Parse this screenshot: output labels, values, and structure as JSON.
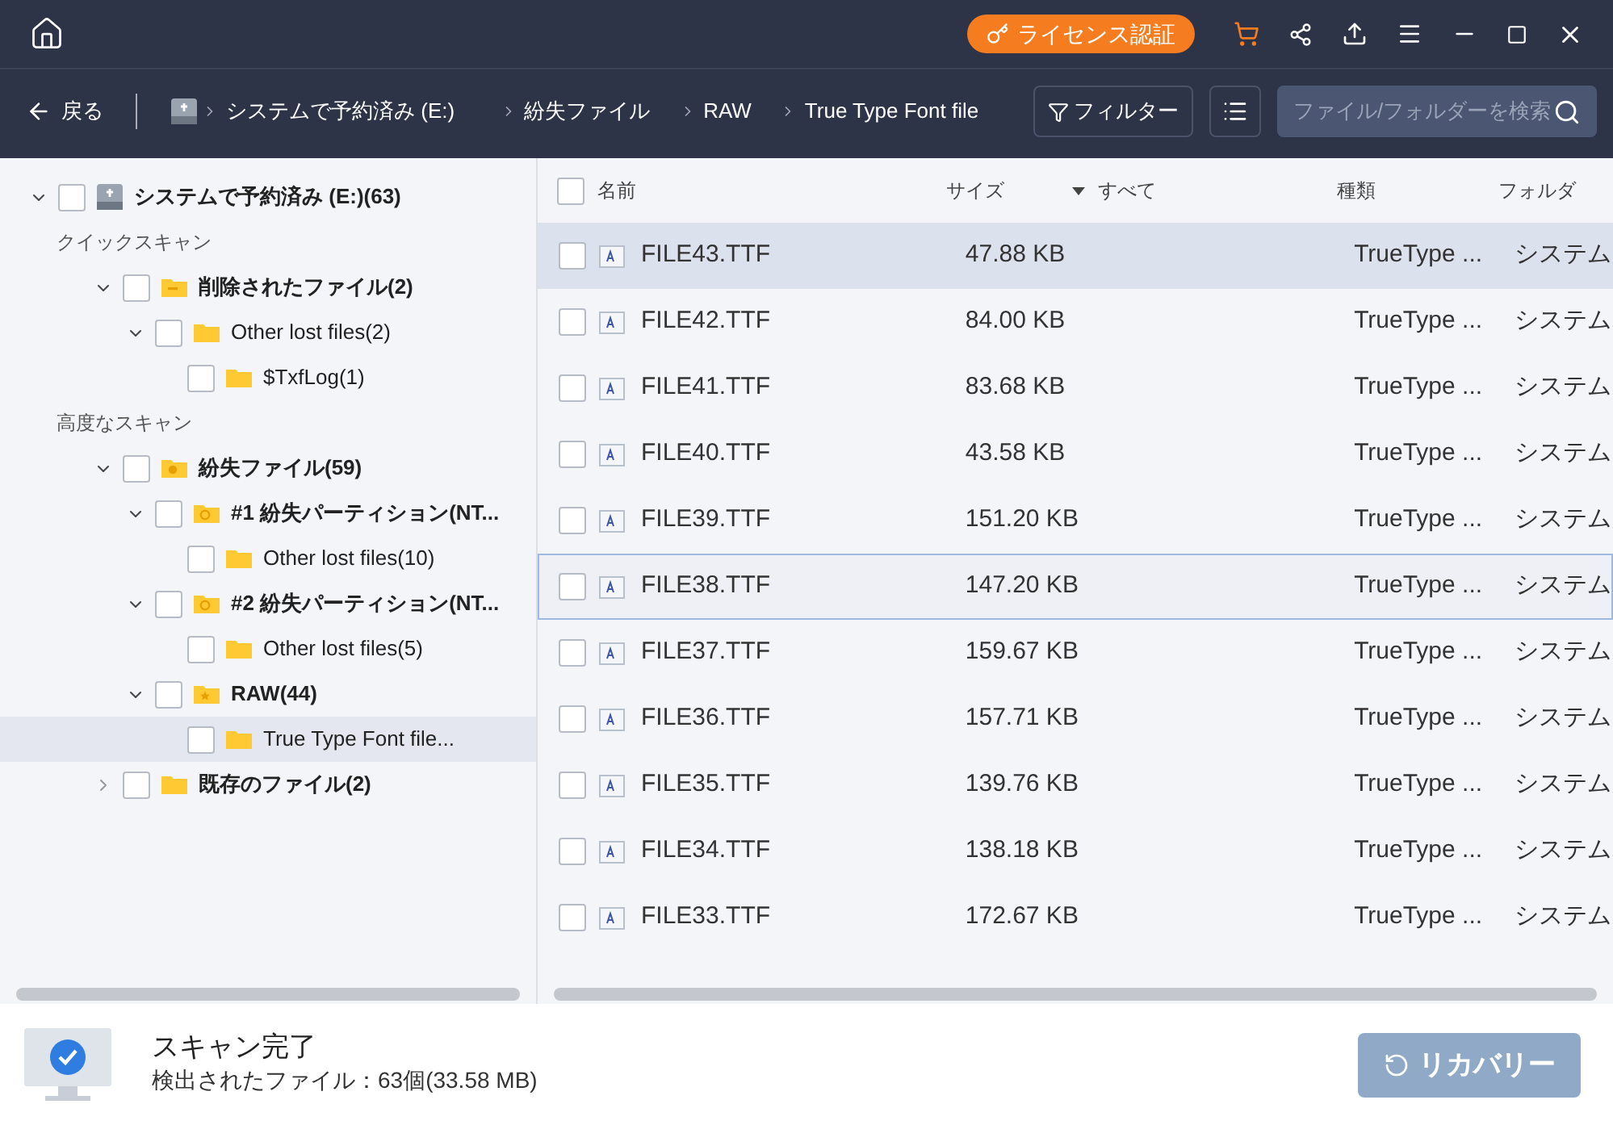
{
  "title_bar": {
    "license_button": "ライセンス認証"
  },
  "nav": {
    "back": "戻る",
    "breadcrumbs": [
      "システムで予約済み (E:)",
      "紛失ファイル",
      "RAW",
      "True Type Font file"
    ],
    "filter": "フィルター",
    "search": {
      "placeholder": "ファイル/フォルダーを検索"
    }
  },
  "tree": [
    {
      "kind": "drive",
      "label": "システムで予約済み (E:)(63)",
      "expanded": true,
      "selected": false,
      "checked": false,
      "children": [
        {
          "kind": "section",
          "label": "クイックスキャン"
        },
        {
          "kind": "deleted",
          "label": "削除されたファイル(2)",
          "expanded": true,
          "selected": false,
          "checked": false,
          "children": [
            {
              "kind": "folder",
              "label": "Other lost files(2)",
              "expanded": true,
              "selected": false,
              "checked": false,
              "children": [
                {
                  "kind": "folder",
                  "label": "$TxfLog(1)",
                  "selected": false,
                  "checked": false
                }
              ]
            }
          ]
        },
        {
          "kind": "section",
          "label": "高度なスキャン"
        },
        {
          "kind": "lost",
          "label": "紛失ファイル(59)",
          "expanded": true,
          "selected": false,
          "checked": false,
          "children": [
            {
              "kind": "partition",
              "label": "#1 紛失パーティション(NT...",
              "expanded": true,
              "selected": false,
              "checked": false,
              "children": [
                {
                  "kind": "folder",
                  "label": "Other lost files(10)",
                  "selected": false,
                  "checked": false
                }
              ]
            },
            {
              "kind": "partition",
              "label": "#2 紛失パーティション(NT...",
              "expanded": true,
              "selected": false,
              "checked": false,
              "children": [
                {
                  "kind": "folder",
                  "label": "Other lost files(5)",
                  "selected": false,
                  "checked": false
                }
              ]
            },
            {
              "kind": "raw",
              "label": "RAW(44)",
              "expanded": true,
              "selected": false,
              "checked": false,
              "children": [
                {
                  "kind": "folder",
                  "label": "True Type Font file...",
                  "selected": true,
                  "checked": false
                }
              ]
            }
          ]
        },
        {
          "kind": "existing",
          "label": "既存のファイル(2)",
          "expanded": false,
          "selected": false,
          "checked": false
        }
      ]
    }
  ],
  "table": {
    "select_all": {
      "checked": false
    },
    "columns": [
      "名前",
      "サイズ",
      "すべて",
      "種類",
      "フォルダ"
    ],
    "rows": [
      {
        "name": "FILE43.TTF",
        "size": "47.88 KB",
        "type": "TrueType ...",
        "folder": "システム",
        "selected": true,
        "focused": false,
        "checked": false
      },
      {
        "name": "FILE42.TTF",
        "size": "84.00 KB",
        "type": "TrueType ...",
        "folder": "システム",
        "selected": false,
        "focused": false,
        "checked": false
      },
      {
        "name": "FILE41.TTF",
        "size": "83.68 KB",
        "type": "TrueType ...",
        "folder": "システム",
        "selected": false,
        "focused": false,
        "checked": false
      },
      {
        "name": "FILE40.TTF",
        "size": "43.58 KB",
        "type": "TrueType ...",
        "folder": "システム",
        "selected": false,
        "focused": false,
        "checked": false
      },
      {
        "name": "FILE39.TTF",
        "size": "151.20 KB",
        "type": "TrueType ...",
        "folder": "システム",
        "selected": false,
        "focused": false,
        "checked": false
      },
      {
        "name": "FILE38.TTF",
        "size": "147.20 KB",
        "type": "TrueType ...",
        "folder": "システム",
        "selected": false,
        "focused": true,
        "checked": false
      },
      {
        "name": "FILE37.TTF",
        "size": "159.67 KB",
        "type": "TrueType ...",
        "folder": "システム",
        "selected": false,
        "focused": false,
        "checked": false
      },
      {
        "name": "FILE36.TTF",
        "size": "157.71 KB",
        "type": "TrueType ...",
        "folder": "システム",
        "selected": false,
        "focused": false,
        "checked": false
      },
      {
        "name": "FILE35.TTF",
        "size": "139.76 KB",
        "type": "TrueType ...",
        "folder": "システム",
        "selected": false,
        "focused": false,
        "checked": false
      },
      {
        "name": "FILE34.TTF",
        "size": "138.18 KB",
        "type": "TrueType ...",
        "folder": "システム",
        "selected": false,
        "focused": false,
        "checked": false
      },
      {
        "name": "FILE33.TTF",
        "size": "172.67 KB",
        "type": "TrueType ...",
        "folder": "システム",
        "selected": false,
        "focused": false,
        "checked": false
      }
    ]
  },
  "status": {
    "title": "スキャン完了",
    "detail": "検出されたファイル：63個(33.58 MB)",
    "recover_button": "リカバリー"
  }
}
